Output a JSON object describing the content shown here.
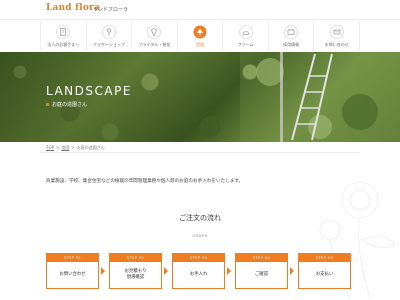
{
  "header": {
    "logo": "Land flora",
    "logo_sub": "ランドフローラ"
  },
  "nav": [
    {
      "label": "法人のお客さまへ",
      "icon": "building-icon"
    },
    {
      "label": "フラワーショップ",
      "icon": "flower-icon"
    },
    {
      "label": "ブライダル・装花",
      "icon": "bouquet-icon"
    },
    {
      "label": "造園",
      "icon": "garden-icon",
      "active": true
    },
    {
      "label": "ファーム",
      "icon": "farm-icon"
    },
    {
      "label": "採用情報",
      "icon": "recruit-icon"
    },
    {
      "label": "お問い合わせ",
      "icon": "mail-icon"
    }
  ],
  "hero": {
    "title": "LANDSCAPE",
    "subtitle": "お庭の造園さん"
  },
  "breadcrumb": {
    "items": [
      "TOP",
      "造園",
      "お庭の造園さん"
    ],
    "separator": ">"
  },
  "intro": "商業施設、学校、集合住宅などの植栽の年間管理業務や個人邸のお庭のお手入れをいたします。",
  "order_flow": {
    "title": "ご注文の流れ",
    "subtitle": "ORDER",
    "steps": [
      {
        "label": "STEP 01",
        "text": "お問い合わせ"
      },
      {
        "label": "STEP 02",
        "text": "お見積もり\n現場確認"
      },
      {
        "label": "STEP 03",
        "text": "お手入れ"
      },
      {
        "label": "STEP 04",
        "text": "ご確認"
      },
      {
        "label": "STEP 05",
        "text": "お支払い"
      }
    ]
  },
  "colors": {
    "accent": "#ef7d22",
    "text": "#444444"
  }
}
